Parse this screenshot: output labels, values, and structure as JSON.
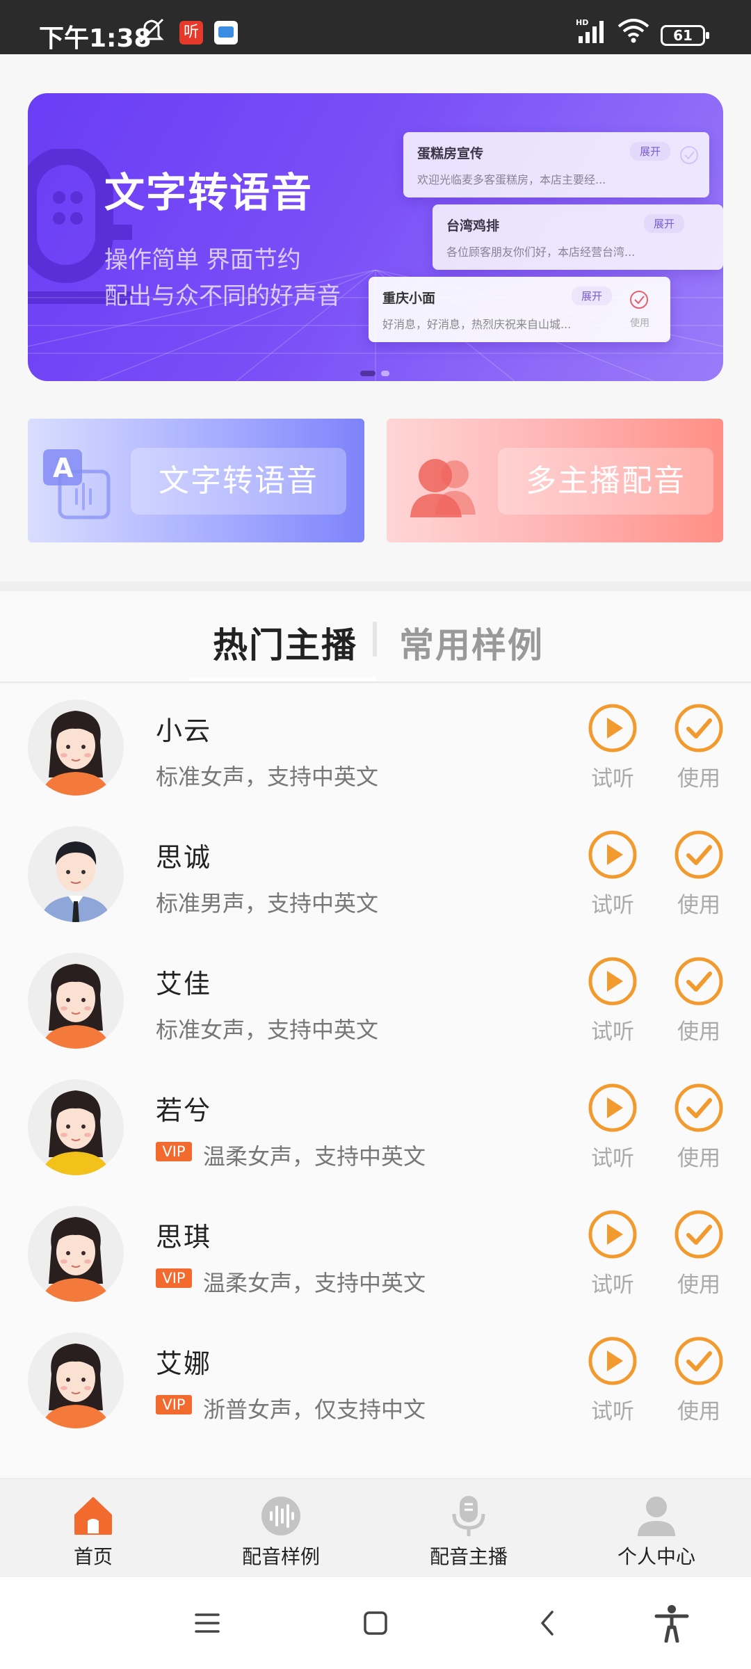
{
  "status_bar": {
    "time": "下午1:38",
    "app1": "听",
    "battery": "61",
    "network": "HD"
  },
  "banner": {
    "title": "文字转语音",
    "subtitle_line1": "操作简单 界面节约",
    "subtitle_line2": "配出与众不同的好声音",
    "cards": [
      {
        "title": "蛋糕房宣传",
        "tag": "展开",
        "text": "欢迎光临麦多客蛋糕房，本店主要经..."
      },
      {
        "title": "台湾鸡排",
        "tag": "展开",
        "text": "各位顾客朋友你们好，本店经营台湾..."
      },
      {
        "title": "重庆小面",
        "tag": "展开",
        "text": "好消息，好消息，热烈庆祝来自山城...",
        "action": "使用"
      }
    ],
    "page_count": 2,
    "active_page": 1
  },
  "features": [
    {
      "label": "文字转语音",
      "icon": "text-to-speech-icon"
    },
    {
      "label": "多主播配音",
      "icon": "multi-anchor-icon"
    }
  ],
  "tabs": {
    "active": "热门主播",
    "other": "常用样例"
  },
  "anchors": [
    {
      "name": "小云",
      "desc": "标准女声，支持中英文",
      "vip": false,
      "avatar": "female-avatar-orange",
      "play_label": "试听",
      "use_label": "使用"
    },
    {
      "name": "思诚",
      "desc": "标准男声，支持中英文",
      "vip": false,
      "avatar": "male-avatar-suit",
      "play_label": "试听",
      "use_label": "使用"
    },
    {
      "name": "艾佳",
      "desc": "标准女声，支持中英文",
      "vip": false,
      "avatar": "female-avatar-orange",
      "play_label": "试听",
      "use_label": "使用"
    },
    {
      "name": "若兮",
      "desc": "温柔女声，支持中英文",
      "vip": true,
      "vip_label": "VIP",
      "avatar": "female-avatar-yellow",
      "play_label": "试听",
      "use_label": "使用"
    },
    {
      "name": "思琪",
      "desc": "温柔女声，支持中英文",
      "vip": true,
      "vip_label": "VIP",
      "avatar": "female-avatar-orange",
      "play_label": "试听",
      "use_label": "使用"
    },
    {
      "name": "艾娜",
      "desc": "浙普女声，仅支持中文",
      "vip": true,
      "vip_label": "VIP",
      "avatar": "female-avatar-orange",
      "play_label": "试听",
      "use_label": "使用"
    }
  ],
  "bottom_nav": [
    {
      "label": "首页",
      "icon": "home-icon",
      "active": true
    },
    {
      "label": "配音样例",
      "icon": "sound-wave-icon",
      "active": false
    },
    {
      "label": "配音主播",
      "icon": "microphone-icon",
      "active": false
    },
    {
      "label": "个人中心",
      "icon": "user-icon",
      "active": false
    }
  ],
  "colors": {
    "accent": "#f39a2e",
    "brand_purple": "#7a4ff7",
    "vip": "#f26a2e",
    "home_active": "#f26a2e"
  }
}
